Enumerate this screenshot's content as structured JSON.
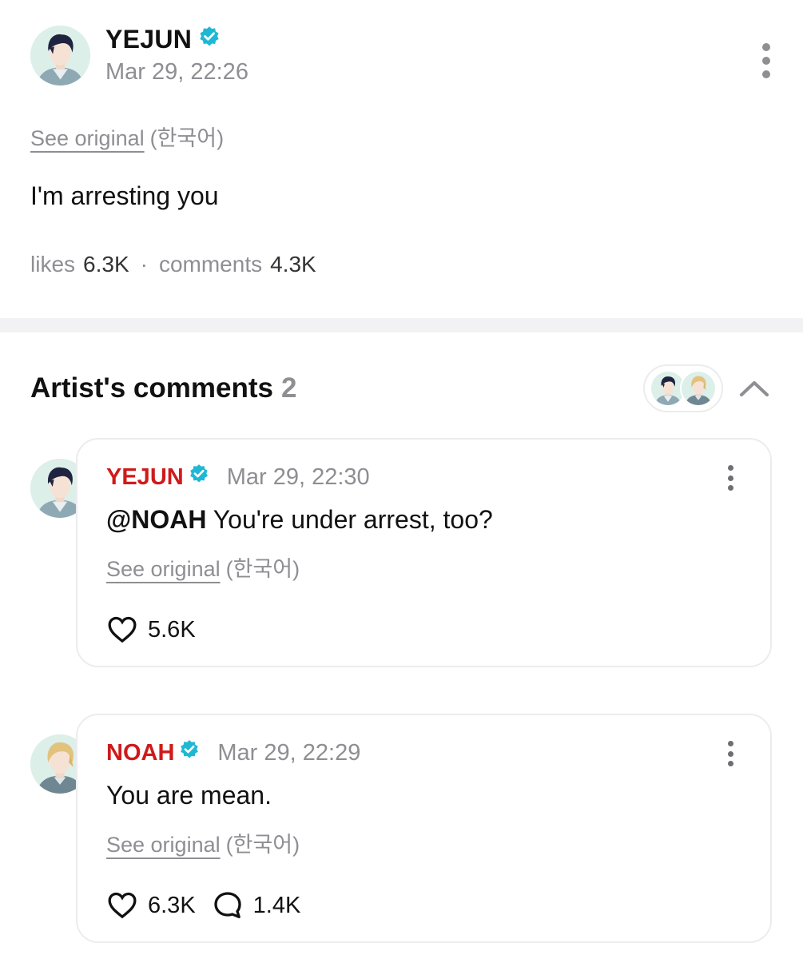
{
  "post": {
    "author": "YEJUN",
    "time": "Mar 29, 22:26",
    "see_original": "See original",
    "language": "(한국어)",
    "body": "I'm arresting you",
    "likes_label": "likes",
    "likes_count": "6.3K",
    "separator": "·",
    "comments_label": "comments",
    "comments_count": "4.3K"
  },
  "artist_comments": {
    "title": "Artist's comments",
    "count": "2",
    "comments": [
      {
        "author": "YEJUN",
        "time": "Mar 29, 22:30",
        "mention": "@NOAH",
        "text": " You're under arrest, too?",
        "see_original": "See original",
        "language": "(한국어)",
        "likes": "5.6K"
      },
      {
        "author": "NOAH",
        "time": "Mar 29, 22:29",
        "text": "You are mean.",
        "see_original": "See original",
        "language": "(한국어)",
        "likes": "6.3K",
        "replies": "1.4K"
      }
    ]
  },
  "colors": {
    "author_red": "#cf1a1a",
    "verified_teal": "#1fb8d4",
    "muted_gray": "#8e8e93",
    "divider": "#f2f2f4"
  },
  "icons": [
    "verified-badge-icon",
    "more-vertical-icon",
    "chevron-up-icon",
    "heart-icon",
    "comment-bubble-icon"
  ]
}
